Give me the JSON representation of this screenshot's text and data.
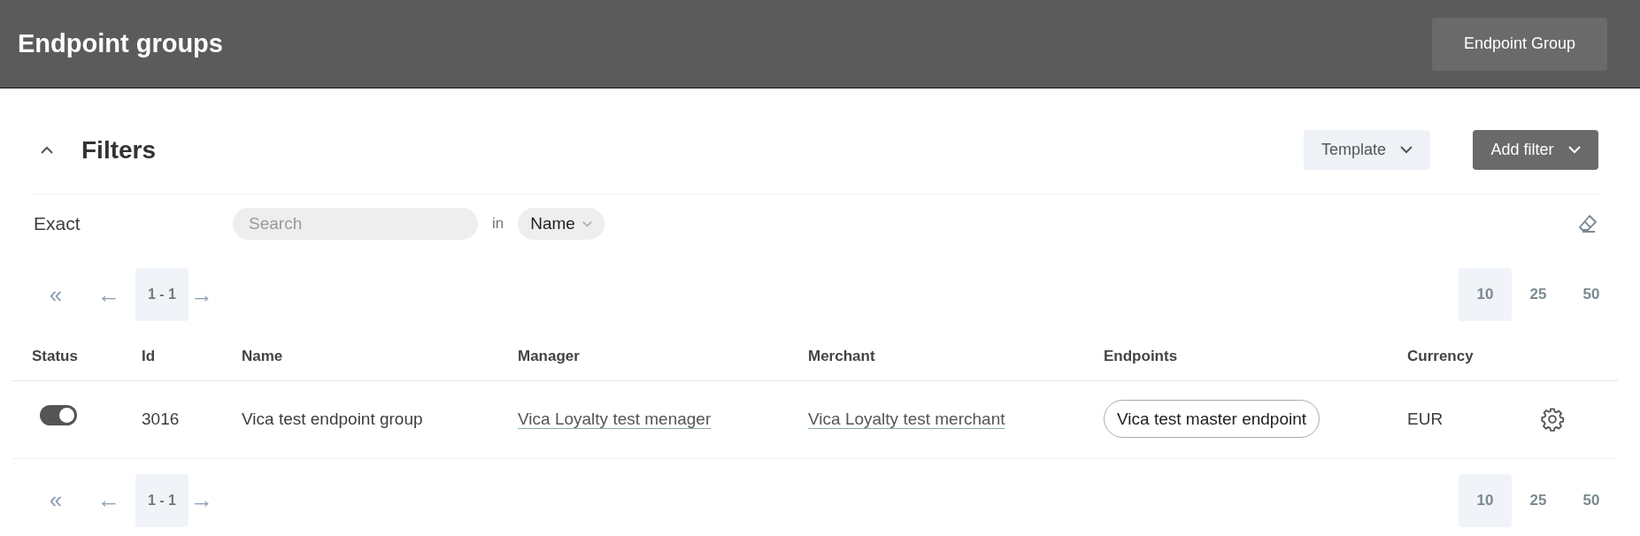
{
  "header": {
    "title": "Endpoint groups",
    "button": "Endpoint Group"
  },
  "filters": {
    "title": "Filters",
    "expanded": true,
    "template_button": "Template",
    "add_button": "Add filter",
    "row": {
      "label": "Exact",
      "search_placeholder": "Search",
      "in_label": "in",
      "field": "Name"
    }
  },
  "pagination_top": {
    "first": "«",
    "prev": "←",
    "range": "1 - 1",
    "next": "→",
    "page_sizes": [
      {
        "label": "10",
        "selected": true
      },
      {
        "label": "25",
        "selected": false
      },
      {
        "label": "50",
        "selected": false
      }
    ]
  },
  "table": {
    "columns": [
      "Status",
      "Id",
      "Name",
      "Manager",
      "Merchant",
      "Endpoints",
      "Currency"
    ],
    "rows": [
      {
        "on": true,
        "id": "3016",
        "name": "Vica test endpoint group",
        "manager": "Vica Loyalty test menager",
        "merchant": "Vica Loyalty test merchant",
        "endpoints": [
          "Vica test master endpoint"
        ],
        "currency": "EUR"
      }
    ]
  },
  "pagination_bottom": {
    "first": "«",
    "prev": "←",
    "range": "1 - 1",
    "next": "→",
    "page_sizes": [
      {
        "label": "10",
        "selected": true
      },
      {
        "label": "25",
        "selected": false
      },
      {
        "label": "50",
        "selected": false
      }
    ]
  }
}
